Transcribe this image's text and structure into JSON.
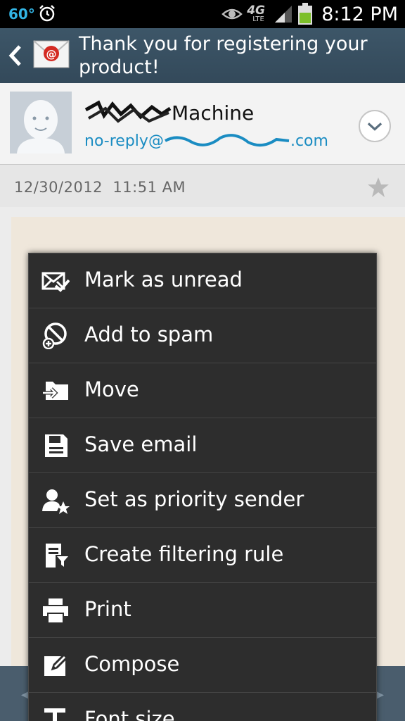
{
  "status_bar": {
    "temperature": "60°",
    "network": "4G",
    "network_sub": "LTE",
    "time": "8:12 PM",
    "icons": [
      "alarm-icon",
      "eye-icon",
      "signal-icon",
      "battery-icon"
    ]
  },
  "action_bar": {
    "title": "Thank you for registering your product!",
    "icons": [
      "back-icon",
      "email-app-icon"
    ]
  },
  "sender": {
    "name_visible": "Machine",
    "email_prefix": "no-reply@",
    "email_suffix": ".com"
  },
  "message": {
    "date": "12/30/2012",
    "time": "11:51 AM"
  },
  "menu": {
    "items": [
      {
        "label": "Mark as unread",
        "icon": "mark-unread-icon"
      },
      {
        "label": "Add to spam",
        "icon": "spam-icon"
      },
      {
        "label": "Move",
        "icon": "move-folder-icon"
      },
      {
        "label": "Save email",
        "icon": "save-icon"
      },
      {
        "label": "Set as priority sender",
        "icon": "priority-sender-icon"
      },
      {
        "label": "Create filtering rule",
        "icon": "filter-rule-icon"
      },
      {
        "label": "Print",
        "icon": "print-icon"
      },
      {
        "label": "Compose",
        "icon": "compose-icon"
      },
      {
        "label": "Font size",
        "icon": "font-size-icon"
      }
    ]
  },
  "colors": {
    "action_bar": "#3a5263",
    "link": "#1a8cc2",
    "menu_bg": "#2d2d2d",
    "temp": "#33b5e5",
    "battery": "#7cbf2a"
  }
}
